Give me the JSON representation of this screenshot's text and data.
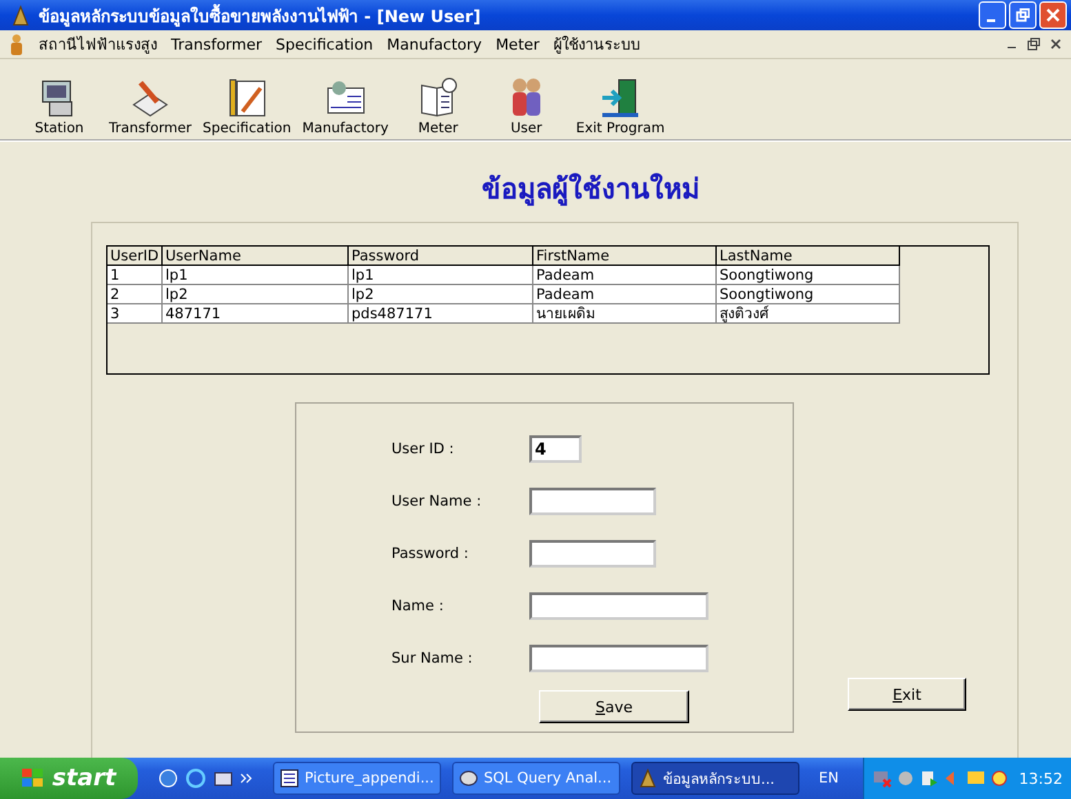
{
  "window": {
    "title": "ข้อมูลหลักระบบข้อมูลใบซื้อขายพลังงานไฟฟ้า - [New User]"
  },
  "menu": [
    "สถานีไฟฟ้าแรงสูง",
    "Transformer",
    "Specification",
    "Manufactory",
    "Meter",
    "ผู้ใช้งานระบบ"
  ],
  "toolbar": [
    {
      "label": "Station",
      "kind": "station"
    },
    {
      "label": "Transformer",
      "kind": "transformer"
    },
    {
      "label": "Specification",
      "kind": "specification"
    },
    {
      "label": "Manufactory",
      "kind": "manufactory"
    },
    {
      "label": "Meter",
      "kind": "meter"
    },
    {
      "label": "User",
      "kind": "user"
    },
    {
      "label": "Exit Program",
      "kind": "exit"
    }
  ],
  "heading": "ข้อมูลผู้ใช้งานใหม่",
  "table": {
    "columns": [
      "UserID",
      "UserName",
      "Password",
      "FirstName",
      "LastName"
    ],
    "rows": [
      [
        "1",
        "lp1",
        "lp1",
        "Padeam",
        "Soongtiwong"
      ],
      [
        "2",
        "lp2",
        "lp2",
        "Padeam",
        "Soongtiwong"
      ],
      [
        "3",
        "487171",
        "pds487171",
        "นายเผดิม",
        "สูงติวงศ์"
      ]
    ]
  },
  "form": {
    "fields": [
      {
        "label": "User ID :",
        "value": "4"
      },
      {
        "label": "User Name :"
      },
      {
        "label": "Password :"
      },
      {
        "label": "Name :"
      },
      {
        "label": "Sur Name :"
      }
    ],
    "save_button": "Save",
    "exit_button": "Exit"
  },
  "taskbar": {
    "start": "start",
    "tasks": [
      {
        "label": "Picture_appendi...",
        "kind": "word",
        "selected": false
      },
      {
        "label": "SQL Query Anal...",
        "kind": "sql",
        "selected": false
      },
      {
        "label": "ข้อมูลหลักระบบ...",
        "kind": "app",
        "selected": true
      }
    ],
    "language": "EN",
    "clock": "13:52"
  }
}
